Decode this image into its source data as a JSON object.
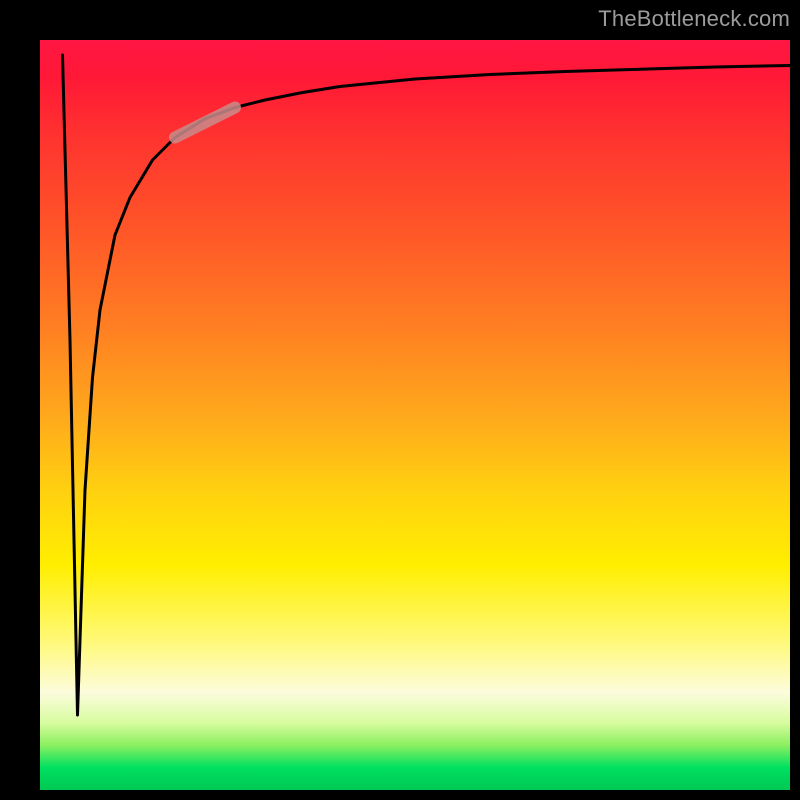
{
  "watermark": "TheBottleneck.com",
  "chart_data": {
    "type": "line",
    "title": "",
    "xlabel": "",
    "ylabel": "",
    "xlim": [
      0,
      100
    ],
    "ylim": [
      0,
      100
    ],
    "grid": false,
    "legend": false,
    "series": [
      {
        "name": "curve",
        "x": [
          3,
          4,
          5,
          6,
          7,
          8,
          10,
          12,
          15,
          18,
          22,
          26,
          30,
          35,
          40,
          50,
          60,
          70,
          80,
          90,
          100
        ],
        "y": [
          98,
          60,
          10,
          40,
          55,
          64,
          74,
          79,
          84,
          87,
          89.5,
          91,
          92,
          93,
          93.8,
          94.8,
          95.4,
          95.8,
          96.1,
          96.4,
          96.6
        ]
      },
      {
        "name": "highlight-segment",
        "x": [
          18,
          26
        ],
        "y": [
          87,
          91
        ]
      }
    ],
    "colors": {
      "curve": "#000000",
      "highlight": "#c98b8b"
    }
  }
}
